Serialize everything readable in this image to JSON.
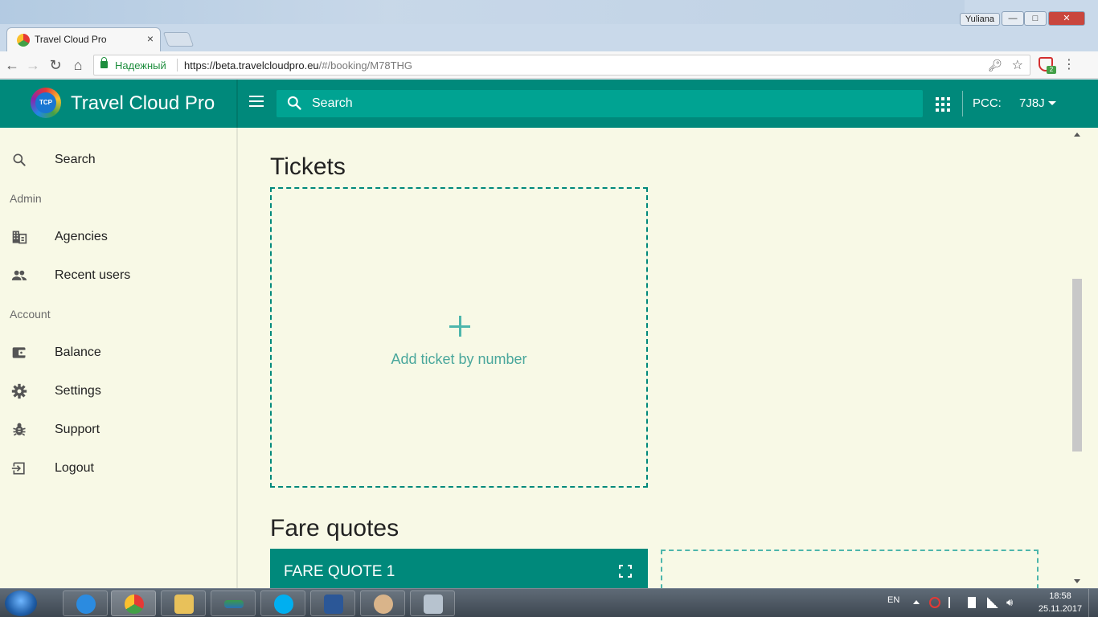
{
  "browser": {
    "window_user": "Yuliana",
    "tab": {
      "title": "Travel Cloud Pro",
      "close_glyph": "×"
    },
    "omnibox": {
      "security_label": "Надежный",
      "url_host": "https://beta.travelcloudpro.eu",
      "url_path": "/#/booking/M78THG"
    },
    "extension_badge": "2"
  },
  "app": {
    "brand": {
      "logo_text": "TCP",
      "name": "Travel Cloud Pro"
    },
    "search_placeholder": "Search",
    "pcc": {
      "label": "PCC:",
      "value": "7J8J"
    },
    "accent_color": "#00897b"
  },
  "sidebar": {
    "items": [
      {
        "label": "Search",
        "icon": "search-icon"
      },
      {
        "label": "Agencies",
        "icon": "building-icon"
      },
      {
        "label": "Recent users",
        "icon": "people-icon"
      },
      {
        "label": "Balance",
        "icon": "wallet-icon"
      },
      {
        "label": "Settings",
        "icon": "gear-icon"
      },
      {
        "label": "Support",
        "icon": "bug-icon"
      },
      {
        "label": "Logout",
        "icon": "logout-icon"
      }
    ],
    "sections": {
      "admin": "Admin",
      "account": "Account"
    }
  },
  "content": {
    "tickets_heading": "Tickets",
    "add_ticket_label": "Add ticket by number",
    "fare_quotes_heading": "Fare quotes",
    "fare_quote_card_title": "FARE QUOTE 1"
  },
  "taskbar": {
    "language": "EN",
    "time": "18:58",
    "date": "25.11.2017"
  }
}
